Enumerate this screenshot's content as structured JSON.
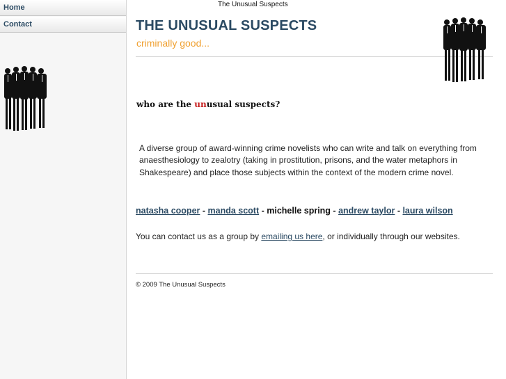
{
  "top_caption": "The Unusual Suspects",
  "nav": {
    "home": "Home",
    "contact": "Contact"
  },
  "header": {
    "title": "THE UNUSUAL SUSPECTS",
    "tagline": "criminally good..."
  },
  "intro": {
    "question_prefix": "who are the ",
    "question_highlight": "un",
    "question_suffix": "usual suspects?",
    "description": "A diverse group of award-winning crime novelists who can write and talk on everything from anaesthesiology to zealotry (taking in prostitution, prisons, and the water metaphors in Shakespeare) and place those subjects within the context of the modern crime novel."
  },
  "authors": {
    "natasha": "natasha cooper",
    "manda": " manda scott",
    "michelle": "michelle spring",
    "andrew": "andrew taylor",
    "laura": "laura wilson",
    "separator": " - "
  },
  "contact": {
    "prefix": "You can contact us as a group by ",
    "link": "emailing us here",
    "suffix": ", or individually through our websites."
  },
  "footer": {
    "copyright": "© 2009 The Unusual Suspects"
  },
  "colors": {
    "title": "#2b4a63",
    "tagline": "#f0a030",
    "highlight": "#c61e1e"
  },
  "icons": {
    "logo": "silhouette-group-icon"
  }
}
